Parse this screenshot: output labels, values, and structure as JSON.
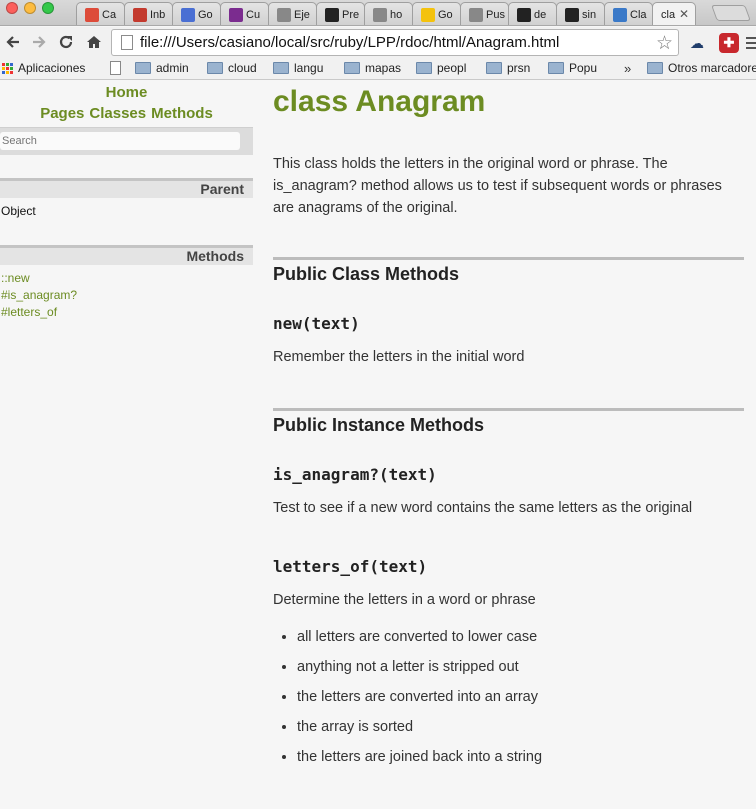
{
  "browser": {
    "tabs": [
      {
        "label": "Ca",
        "icon": "google-plus-icon",
        "color": "#dd4b39"
      },
      {
        "label": "Inb",
        "icon": "gmail-icon",
        "color": "#c33a2e"
      },
      {
        "label": "Go",
        "icon": "calendar-icon",
        "color": "#4a6fd3"
      },
      {
        "label": "Cu",
        "icon": "ull-icon",
        "color": "#7b2c8f"
      },
      {
        "label": "Eje",
        "icon": "page-icon",
        "color": "#888888"
      },
      {
        "label": "Pre",
        "icon": "github-icon",
        "color": "#222222"
      },
      {
        "label": "ho",
        "icon": "page-icon",
        "color": "#888888"
      },
      {
        "label": "Go",
        "icon": "keep-icon",
        "color": "#f4c20d"
      },
      {
        "label": "Pus",
        "icon": "page-icon",
        "color": "#888888"
      },
      {
        "label": "de",
        "icon": "github-icon",
        "color": "#222222"
      },
      {
        "label": "sin",
        "icon": "github-icon",
        "color": "#222222"
      },
      {
        "label": "Cla",
        "icon": "mail-icon",
        "color": "#3a79c8"
      },
      {
        "label": "cla",
        "icon": "none",
        "color": "#f2f2f2",
        "active": true
      }
    ],
    "close_glyph": "✕",
    "url": "file:///Users/casiano/local/src/ruby/LPP/rdoc/html/Anagram.html",
    "bookmarks": [
      {
        "label": "Aplicaciones",
        "icon": "apps-icon"
      },
      {
        "label": "",
        "icon": "document-icon"
      },
      {
        "label": "admin",
        "icon": "folder-icon"
      },
      {
        "label": "cloud",
        "icon": "folder-icon"
      },
      {
        "label": "langu",
        "icon": "folder-icon"
      },
      {
        "label": "mapas",
        "icon": "folder-icon"
      },
      {
        "label": "peopl",
        "icon": "folder-icon"
      },
      {
        "label": "prsn",
        "icon": "folder-icon"
      },
      {
        "label": "Popu",
        "icon": "folder-icon"
      }
    ],
    "more_bookmarks": "»",
    "other_bookmarks": "Otros marcadores"
  },
  "sidebar": {
    "home": "Home",
    "nav": [
      "Pages",
      "Classes",
      "Methods"
    ],
    "search_placeholder": "Search",
    "parent_heading": "Parent",
    "parent_value": "Object",
    "methods_heading": "Methods",
    "methods": [
      "::new",
      "#is_anagram?",
      "#letters_of"
    ]
  },
  "main": {
    "title": "class Anagram",
    "description": "This class holds the letters in the original word or phrase. The is_anagram? method allows us to test if subsequent words or phrases are anagrams of the original.",
    "class_methods_heading": "Public Class Methods",
    "new_sig": "new(text)",
    "new_desc": "Remember the letters in the initial word",
    "instance_methods_heading": "Public Instance Methods",
    "is_anagram_sig": "is_anagram?(text)",
    "is_anagram_desc": "Test to see if a new word contains the same letters as the original",
    "letters_of_sig": "letters_of(text)",
    "letters_of_desc": "Determine the letters in a word or phrase",
    "letters_of_steps": [
      "all letters are converted to lower case",
      "anything not a letter is stripped out",
      "the letters are converted into an array",
      "the array is sorted",
      "the letters are joined back into a string"
    ]
  },
  "colors": {
    "accent": "#6c8c22",
    "text": "#333333",
    "rule": "#bcbcbc"
  }
}
